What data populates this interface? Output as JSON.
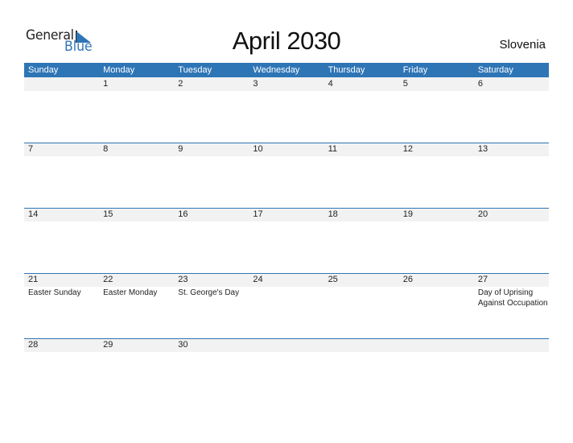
{
  "logo": {
    "word1": "General",
    "word2": "Blue"
  },
  "title": "April 2030",
  "country": "Slovenia",
  "colors": {
    "accent": "#2e75b6",
    "strip": "#f2f2f2"
  },
  "weekdays": [
    "Sunday",
    "Monday",
    "Tuesday",
    "Wednesday",
    "Thursday",
    "Friday",
    "Saturday"
  ],
  "weeks": [
    {
      "days": [
        {
          "num": "",
          "event": ""
        },
        {
          "num": "1",
          "event": ""
        },
        {
          "num": "2",
          "event": ""
        },
        {
          "num": "3",
          "event": ""
        },
        {
          "num": "4",
          "event": ""
        },
        {
          "num": "5",
          "event": ""
        },
        {
          "num": "6",
          "event": ""
        }
      ]
    },
    {
      "days": [
        {
          "num": "7",
          "event": ""
        },
        {
          "num": "8",
          "event": ""
        },
        {
          "num": "9",
          "event": ""
        },
        {
          "num": "10",
          "event": ""
        },
        {
          "num": "11",
          "event": ""
        },
        {
          "num": "12",
          "event": ""
        },
        {
          "num": "13",
          "event": ""
        }
      ]
    },
    {
      "days": [
        {
          "num": "14",
          "event": ""
        },
        {
          "num": "15",
          "event": ""
        },
        {
          "num": "16",
          "event": ""
        },
        {
          "num": "17",
          "event": ""
        },
        {
          "num": "18",
          "event": ""
        },
        {
          "num": "19",
          "event": ""
        },
        {
          "num": "20",
          "event": ""
        }
      ]
    },
    {
      "days": [
        {
          "num": "21",
          "event": "Easter Sunday"
        },
        {
          "num": "22",
          "event": "Easter Monday"
        },
        {
          "num": "23",
          "event": "St. George's Day"
        },
        {
          "num": "24",
          "event": ""
        },
        {
          "num": "25",
          "event": ""
        },
        {
          "num": "26",
          "event": ""
        },
        {
          "num": "27",
          "event": "Day of Uprising Against Occupation"
        }
      ]
    },
    {
      "days": [
        {
          "num": "28",
          "event": ""
        },
        {
          "num": "29",
          "event": ""
        },
        {
          "num": "30",
          "event": ""
        },
        {
          "num": "",
          "event": ""
        },
        {
          "num": "",
          "event": ""
        },
        {
          "num": "",
          "event": ""
        },
        {
          "num": "",
          "event": ""
        }
      ]
    }
  ]
}
